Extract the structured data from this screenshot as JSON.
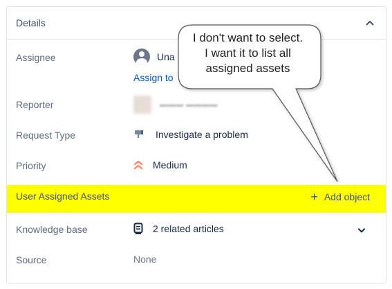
{
  "panel": {
    "title": "Details"
  },
  "fields": {
    "assignee": {
      "label": "Assignee",
      "value": "Una",
      "assign_link": "Assign to"
    },
    "reporter": {
      "label": "Reporter"
    },
    "request_type": {
      "label": "Request Type",
      "value": "Investigate a problem"
    },
    "priority": {
      "label": "Priority",
      "value": "Medium"
    },
    "user_assigned_assets": {
      "label": "User Assigned Assets",
      "action": "Add object"
    },
    "knowledge_base": {
      "label": "Knowledge base",
      "value": "2 related articles"
    },
    "source": {
      "label": "Source",
      "value": "None"
    }
  },
  "callout": {
    "lines": [
      "I don't want to select.",
      "I want it to list all",
      "assigned assets"
    ]
  },
  "colors": {
    "highlight": "#ffff00",
    "link": "#0052cc",
    "priority": "#ff7452"
  }
}
